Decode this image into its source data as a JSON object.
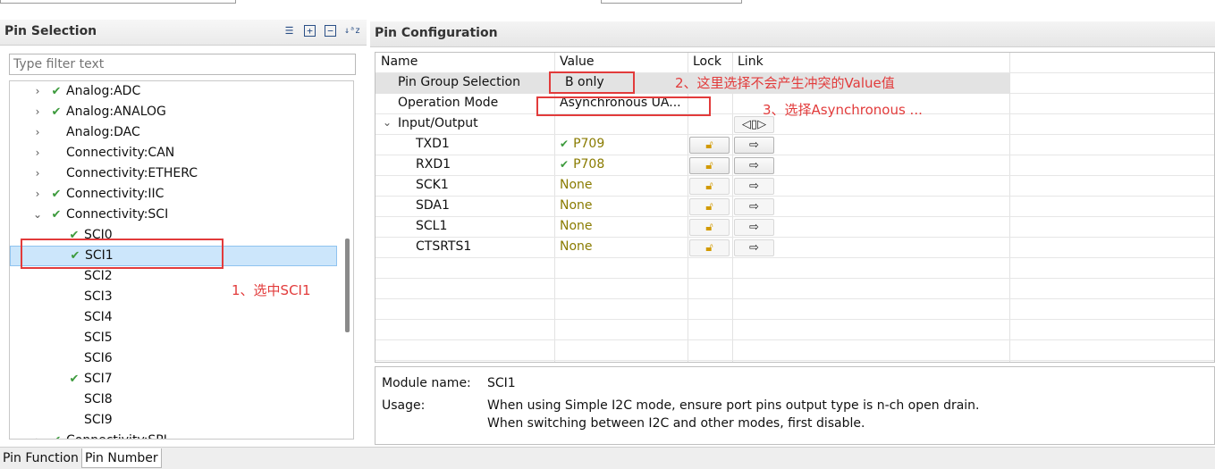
{
  "top": {},
  "left_panel": {
    "title": "Pin Selection",
    "toolbar_icons": [
      "list-icon",
      "expand-all-icon",
      "collapse-all-icon",
      "sort-az-icon"
    ],
    "filter_placeholder": "Type filter text",
    "tree": [
      {
        "label": "Analog:ADC",
        "checked": true,
        "expanded": false,
        "level": 0
      },
      {
        "label": "Analog:ANALOG",
        "checked": true,
        "expanded": false,
        "level": 0
      },
      {
        "label": "Analog:DAC",
        "checked": false,
        "expanded": false,
        "level": 0
      },
      {
        "label": "Connectivity:CAN",
        "checked": false,
        "expanded": false,
        "level": 0
      },
      {
        "label": "Connectivity:ETHERC",
        "checked": false,
        "expanded": false,
        "level": 0
      },
      {
        "label": "Connectivity:IIC",
        "checked": true,
        "expanded": false,
        "level": 0
      },
      {
        "label": "Connectivity:SCI",
        "checked": true,
        "expanded": true,
        "level": 0
      },
      {
        "label": "SCI0",
        "checked": true,
        "level": 1
      },
      {
        "label": "SCI1",
        "checked": true,
        "level": 1,
        "selected": true
      },
      {
        "label": "SCI2",
        "checked": false,
        "level": 1
      },
      {
        "label": "SCI3",
        "checked": false,
        "level": 1
      },
      {
        "label": "SCI4",
        "checked": false,
        "level": 1
      },
      {
        "label": "SCI5",
        "checked": false,
        "level": 1
      },
      {
        "label": "SCI6",
        "checked": false,
        "level": 1
      },
      {
        "label": "SCI7",
        "checked": true,
        "level": 1
      },
      {
        "label": "SCI8",
        "checked": false,
        "level": 1
      },
      {
        "label": "SCI9",
        "checked": false,
        "level": 1
      },
      {
        "label": "Connectivity:SPI",
        "checked": true,
        "expanded": false,
        "level": 0
      }
    ]
  },
  "bottom_tabs": [
    "Pin Function",
    "Pin Number"
  ],
  "right_panel": {
    "title": "Pin Configuration",
    "columns": [
      "Name",
      "Value",
      "Lock",
      "Link"
    ],
    "rows": [
      {
        "name": "Pin Group Selection",
        "value": "B only",
        "checked": false,
        "lock": "",
        "link": ""
      },
      {
        "name": "Operation Mode",
        "value": "Asynchronous UA...",
        "checked": false,
        "lock": "",
        "link": ""
      },
      {
        "name": "Input/Output",
        "value": "",
        "checked": false,
        "lock": "",
        "link": "group-link"
      },
      {
        "name": "TXD1",
        "value": "P709",
        "checked": true,
        "lock": "lock",
        "link": "arrow"
      },
      {
        "name": "RXD1",
        "value": "P708",
        "checked": true,
        "lock": "lock",
        "link": "arrow"
      },
      {
        "name": "SCK1",
        "value": "None",
        "checked": false,
        "lock": "lock-disabled",
        "link": "arrow-disabled"
      },
      {
        "name": "SDA1",
        "value": "None",
        "checked": false,
        "lock": "lock-disabled",
        "link": "arrow-disabled"
      },
      {
        "name": "SCL1",
        "value": "None",
        "checked": false,
        "lock": "lock-disabled",
        "link": "arrow-disabled"
      },
      {
        "name": "CTSRTS1",
        "value": "None",
        "checked": false,
        "lock": "lock-disabled",
        "link": "arrow-disabled"
      }
    ],
    "info": {
      "module_label": "Module name:",
      "module_value": "SCI1",
      "usage_label": "Usage:",
      "usage_line1": "When using Simple I2C mode, ensure port pins output type is n-ch open drain.",
      "usage_line2": "When switching between I2C and other modes, first disable."
    }
  },
  "annotations": {
    "note1": "1、选中SCI1",
    "note2": "2、这里选择不会产生冲突的Value值",
    "note3": "3、选择Asynchronous ...",
    "color": "#e23b3b"
  }
}
